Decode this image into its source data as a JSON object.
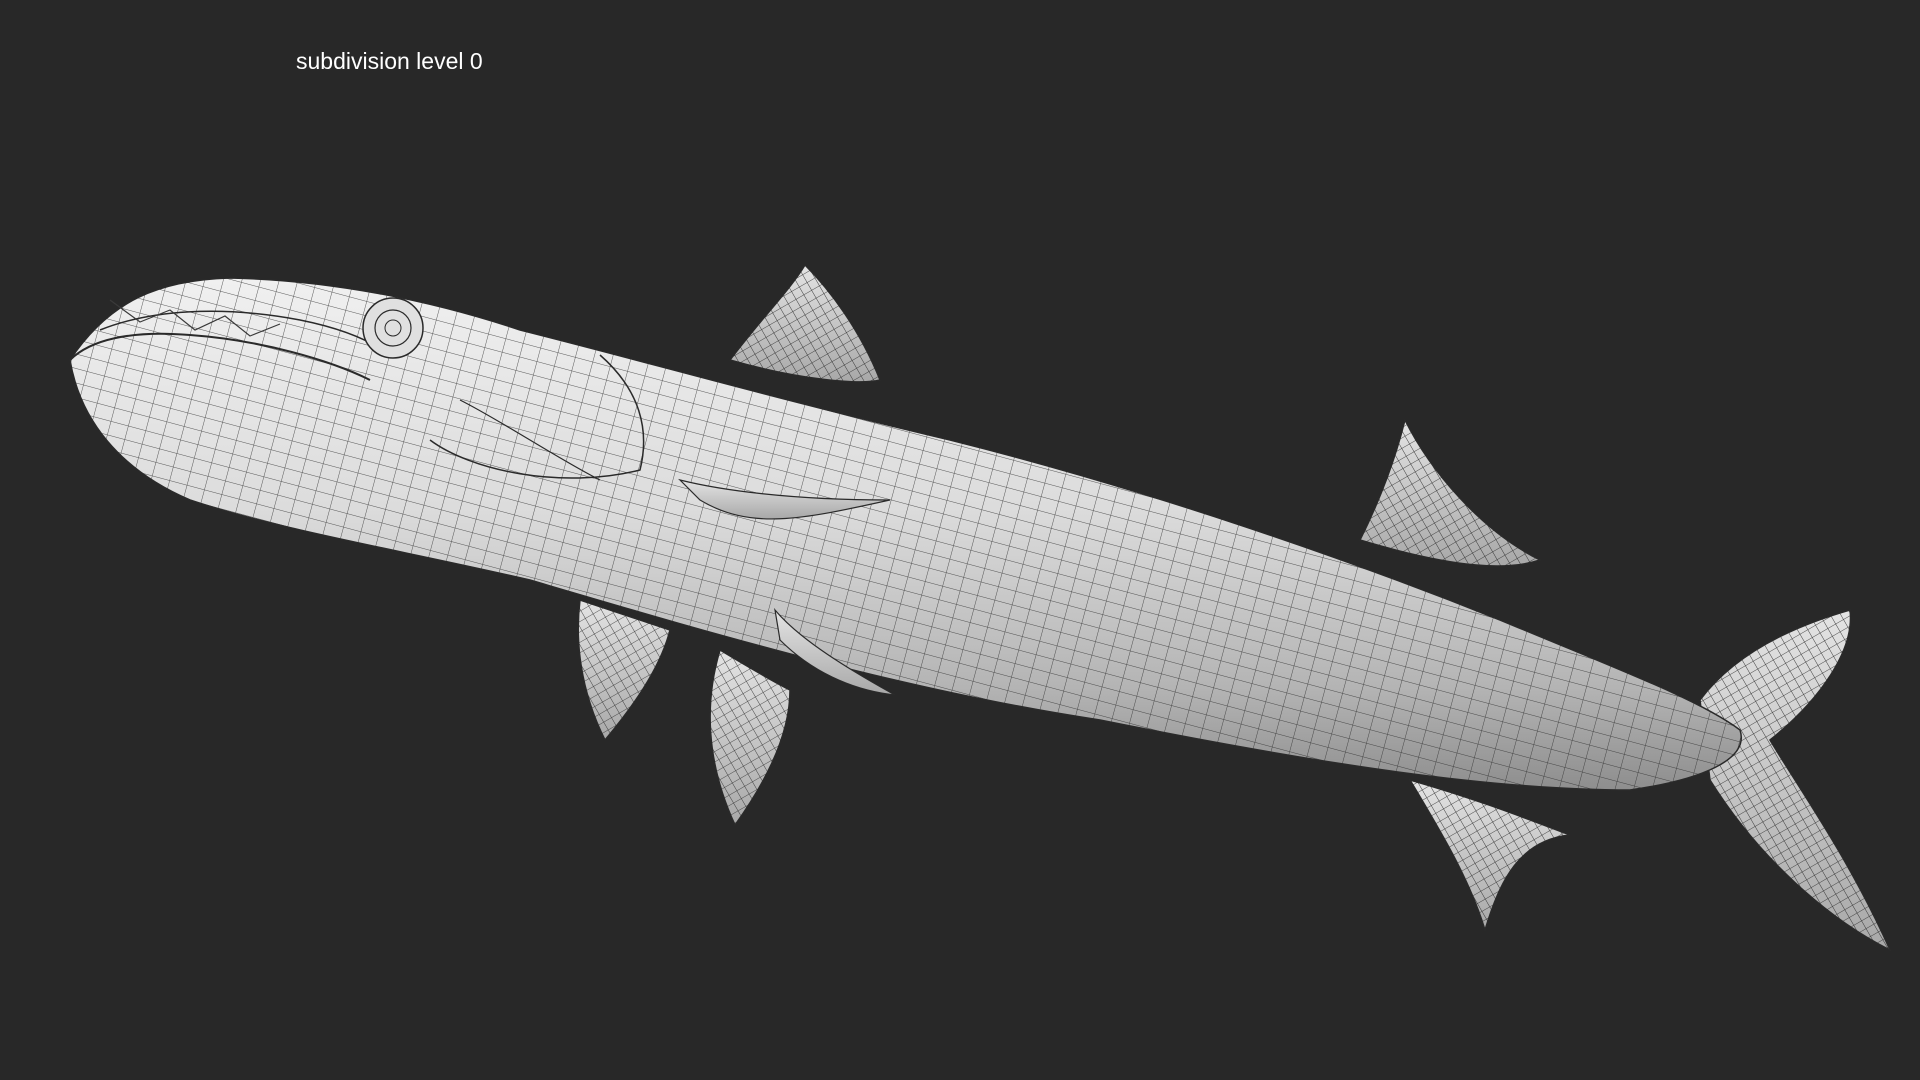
{
  "viewport": {
    "background": "#282828",
    "overlay_label": "subdivision level 0"
  },
  "model": {
    "subject": "barracuda",
    "display_mode": "wireframe-on-shaded",
    "surface_color": "#d8d8d8",
    "wire_color": "#2a2a2a"
  }
}
